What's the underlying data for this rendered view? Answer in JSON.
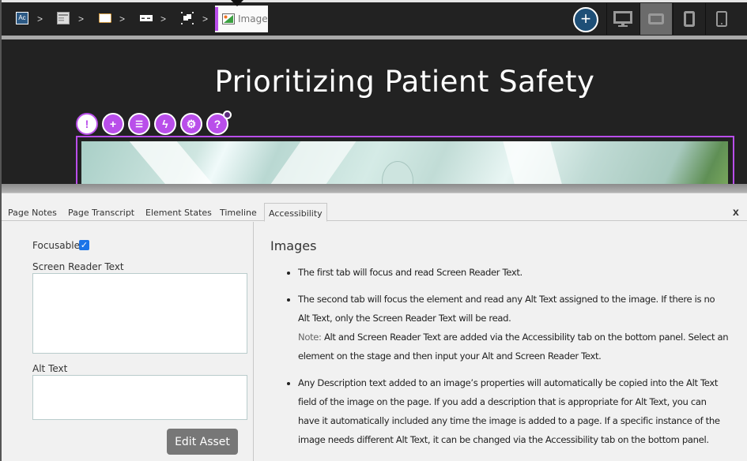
{
  "toolbar": {
    "breadcrumbs": [
      {
        "icon": "course-icon",
        "label": ""
      },
      {
        "icon": "page-icon",
        "label": ""
      },
      {
        "icon": "container-icon",
        "label": ""
      },
      {
        "icon": "row-icon",
        "label": ""
      },
      {
        "icon": "group-icon",
        "label": ""
      }
    ],
    "separator": ">",
    "active_crumb": {
      "icon": "image-icon",
      "label": "Image"
    },
    "add_button": "+",
    "devices": [
      {
        "name": "desktop",
        "active": false
      },
      {
        "name": "tablet-landscape",
        "active": true
      },
      {
        "name": "tablet-portrait",
        "active": false
      },
      {
        "name": "phone",
        "active": false
      }
    ],
    "accent_color": "#b94eea"
  },
  "stage": {
    "title": "Prioritizing Patient Safety",
    "element_controls": [
      {
        "icon": "alert-icon",
        "glyph": "!"
      },
      {
        "icon": "plus-icon",
        "glyph": "+"
      },
      {
        "icon": "sliders-icon",
        "glyph": "☰"
      },
      {
        "icon": "lightning-icon",
        "glyph": "ϟ"
      },
      {
        "icon": "gear-icon",
        "glyph": "⚙"
      },
      {
        "icon": "help-icon",
        "glyph": "?"
      }
    ]
  },
  "panel": {
    "tabs": [
      "Page Notes",
      "Page Transcript",
      "Element States",
      "Timeline",
      "Accessibility"
    ],
    "active_tab": "Accessibility",
    "close_label": "x",
    "focusable_label": "Focusable",
    "focusable_checked": true,
    "screen_reader_label": "Screen Reader Text",
    "screen_reader_value": "",
    "alt_text_label": "Alt Text",
    "alt_text_value": "",
    "edit_asset_label": "Edit Asset",
    "help": {
      "heading": "Images",
      "items": [
        "The first tab will focus and read Screen Reader Text.",
        "The second tab will focus the element and read any Alt Text assigned to the image. If there is no Alt Text, only the Screen Reader Text will be read.",
        "Any Description text added to an image’s properties will automatically be copied into the Alt Text field of the image on the page. If you add a description that is appropriate for Alt Text, you can have it automatically included any time the image is added to a page. If a specific instance of the image needs different Alt Text, it can be changed via the Accessibility tab on the bottom panel."
      ],
      "note_label": "Note:",
      "note_text": " Alt and Screen Reader Text are added via the Accessibility tab on the bottom panel. Select an element on the stage and then input your Alt and Screen Reader Text."
    }
  }
}
